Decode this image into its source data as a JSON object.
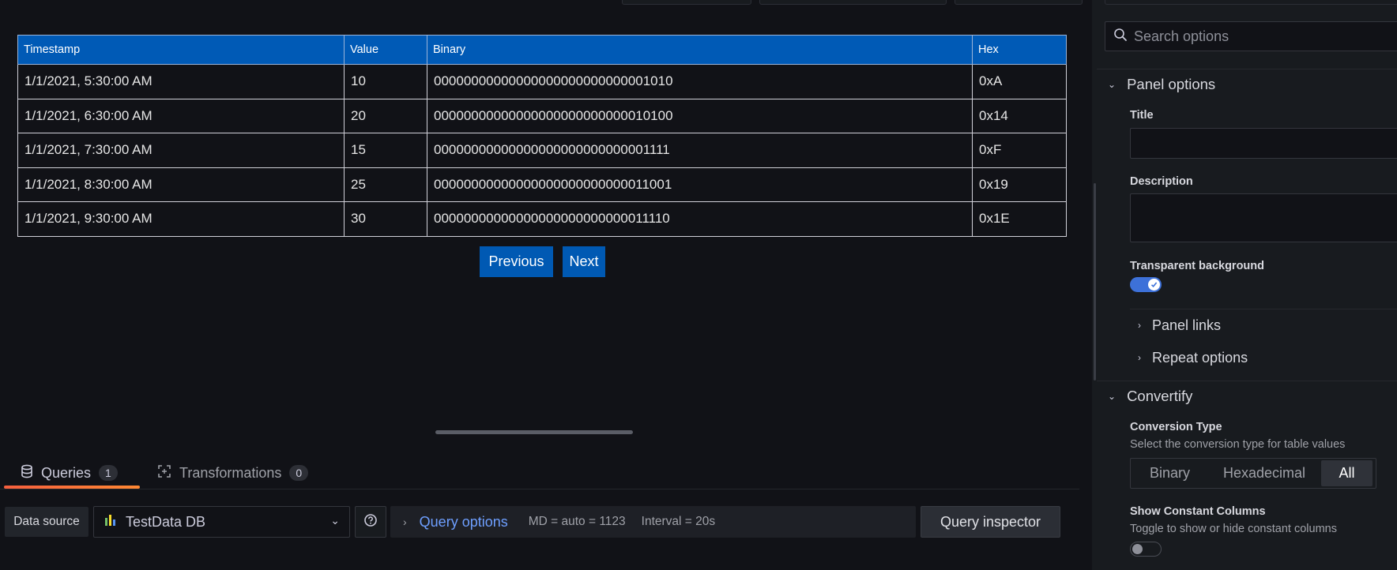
{
  "table": {
    "headers": [
      "Timestamp",
      "Value",
      "Binary",
      "Hex"
    ],
    "rows": [
      [
        "1/1/2021, 5:30:00 AM",
        "10",
        "00000000000000000000000000001010",
        "0xA"
      ],
      [
        "1/1/2021, 6:30:00 AM",
        "20",
        "00000000000000000000000000010100",
        "0x14"
      ],
      [
        "1/1/2021, 7:30:00 AM",
        "15",
        "00000000000000000000000000001111",
        "0xF"
      ],
      [
        "1/1/2021, 8:30:00 AM",
        "25",
        "00000000000000000000000000011001",
        "0x19"
      ],
      [
        "1/1/2021, 9:30:00 AM",
        "30",
        "00000000000000000000000000011110",
        "0x1E"
      ]
    ]
  },
  "pager": {
    "previous": "Previous",
    "next": "Next"
  },
  "tabs": [
    {
      "label": "Queries",
      "count": "1",
      "icon": "database-icon"
    },
    {
      "label": "Transformations",
      "count": "0",
      "icon": "transform-icon"
    }
  ],
  "query_row": {
    "ds_label": "Data source",
    "ds_value": "TestData DB",
    "query_options_label": "Query options",
    "md": "MD = auto = 1123",
    "interval": "Interval = 20s",
    "inspector": "Query inspector"
  },
  "options": {
    "search_placeholder": "Search options",
    "panel_options": {
      "heading": "Panel options",
      "title_label": "Title",
      "title_value": "",
      "description_label": "Description",
      "description_value": "",
      "transparent_label": "Transparent background",
      "transparent_on": true,
      "panel_links": "Panel links",
      "repeat_options": "Repeat options"
    },
    "convertify": {
      "heading": "Convertify",
      "conversion_label": "Conversion Type",
      "conversion_desc": "Select the conversion type for table values",
      "conversion_options": [
        "Binary",
        "Hexadecimal",
        "All"
      ],
      "conversion_selected": "All",
      "constant_label": "Show Constant Columns",
      "constant_desc": "Toggle to show or hide constant columns",
      "constant_on": false
    }
  },
  "colors": {
    "accent": "#3d71d9",
    "table_header": "#005ab6",
    "tab_underline": "#f55f3e",
    "link": "#6e9fff"
  }
}
